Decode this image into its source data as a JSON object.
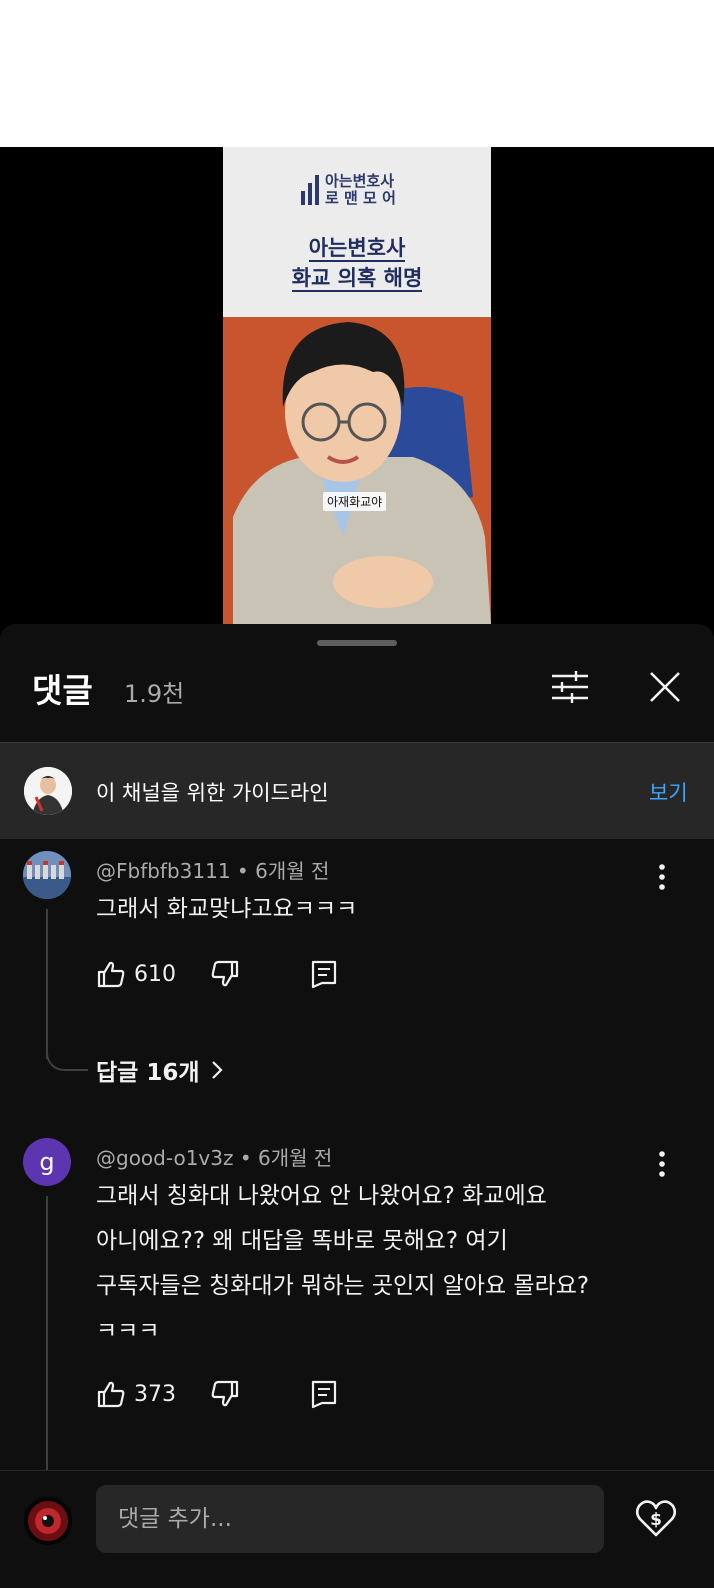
{
  "video": {
    "brand_line1": "아는변호사",
    "brand_line2": "로 맨 모 어",
    "title_line1": "아는변호사",
    "title_line2": "화교 의혹 해명",
    "subtitle": "아재화교야"
  },
  "panel": {
    "title": "댓글",
    "count": "1.9천"
  },
  "guideline": {
    "text": "이 채널을 위한 가이드라인",
    "link": "보기"
  },
  "comments": [
    {
      "author": "@Fbfbfb3111",
      "time": "6개월 전",
      "text_lines": [
        "그래서 화교맞냐고요ㅋㅋㅋ"
      ],
      "likes": "610",
      "replies": "답글 16개"
    },
    {
      "author": "@good-o1v3z",
      "avatar_letter": "g",
      "time": "6개월 전",
      "text_lines": [
        "그래서 칭화대 나왔어요 안 나왔어요? 화교에요",
        "아니에요?? 왜 대답을 똑바로 못해요? 여기",
        "구독자들은 칭화대가 뭐하는 곳인지 알아요 몰라요?",
        "ㅋㅋㅋ"
      ],
      "likes": "373"
    }
  ],
  "input": {
    "placeholder": "댓글 추가..."
  },
  "colors": {
    "accent_link": "#3ea6ff",
    "sheet_bg": "#0f0f0f",
    "avatar_g": "#5e35b1"
  }
}
